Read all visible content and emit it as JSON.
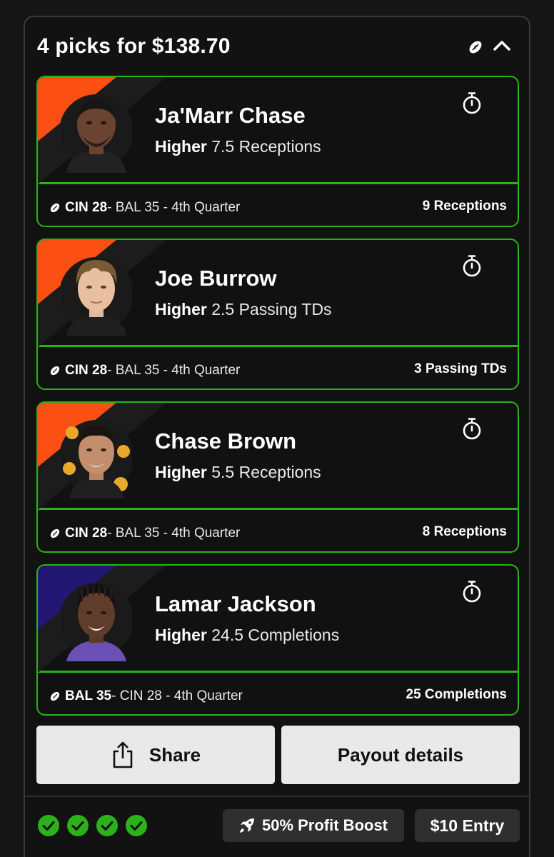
{
  "header": {
    "title": "4 picks for $138.70"
  },
  "picks": [
    {
      "player": "Ja'Marr Chase",
      "direction": "Higher",
      "line": "7.5 Receptions",
      "team": "CIN 28",
      "rest": " - BAL 35 - 4th Quarter",
      "result": "9 Receptions",
      "team_color": "#fb4f14"
    },
    {
      "player": "Joe Burrow",
      "direction": "Higher",
      "line": "2.5 Passing TDs",
      "team": "CIN 28",
      "rest": " - BAL 35 - 4th Quarter",
      "result": "3 Passing TDs",
      "team_color": "#fb4f14"
    },
    {
      "player": "Chase Brown",
      "direction": "Higher",
      "line": "5.5 Receptions",
      "team": "CIN 28",
      "rest": " - BAL 35 - 4th Quarter",
      "result": "8 Receptions",
      "team_color": "#fb4f14"
    },
    {
      "player": "Lamar Jackson",
      "direction": "Higher",
      "line": "24.5 Completions",
      "team": "BAL 35",
      "rest": " - CIN 28 - 4th Quarter",
      "result": "25 Completions",
      "team_color": "#241773"
    }
  ],
  "actions": {
    "share": "Share",
    "payout": "Payout details"
  },
  "footer": {
    "checks": 4,
    "boost": "50% Profit Boost",
    "entry": "$10 Entry"
  },
  "colors": {
    "win_green": "#2bb11a",
    "card_border": "#2bb11a"
  }
}
